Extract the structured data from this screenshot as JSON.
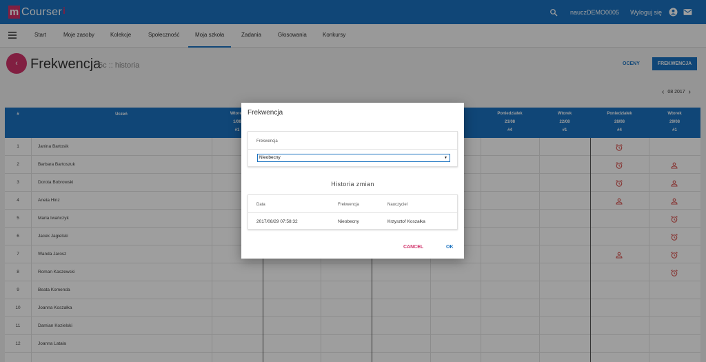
{
  "app": {
    "logo_box": "m",
    "logo_text": "Courser",
    "logo_mark": "i",
    "username": "nauczDEMO0005",
    "logout": "Wyloguj się"
  },
  "nav": {
    "items": [
      "Start",
      "Moje zasoby",
      "Kolekcje",
      "Społeczność",
      "Moja szkoła",
      "Zadania",
      "Głosowania",
      "Konkursy"
    ],
    "active": "Moja szkoła"
  },
  "page": {
    "back_glyph": "‹",
    "title": "Frekwencja",
    "subtitle": "5c :: historia",
    "btn_oceny": "OCENY",
    "btn_frekwencja": "FREKWENCJA"
  },
  "month": {
    "label": "08 2017",
    "prev": "‹",
    "next": "›"
  },
  "grid": {
    "col_num": "#",
    "col_student": "Uczeń",
    "lessons": [
      {
        "day": "Wtorek",
        "date": "1/08",
        "lesson": "#1"
      },
      {
        "day": "Poniedziałek",
        "date": "21/08",
        "lesson": "#4"
      },
      {
        "day": "Wtorek",
        "date": "22/08",
        "lesson": "#1"
      },
      {
        "day": "Poniedziałek",
        "date": "28/08",
        "lesson": "#4"
      },
      {
        "day": "Wtorek",
        "date": "29/08",
        "lesson": "#1"
      }
    ],
    "students": [
      {
        "n": "1",
        "name": "Janina Bartosik",
        "m28": "late",
        "m29": ""
      },
      {
        "n": "2",
        "name": "Barbara Bartoszuk",
        "m28": "late",
        "m29": "absent"
      },
      {
        "n": "3",
        "name": "Dorota Bobrowski",
        "m28": "late",
        "m29": "absent"
      },
      {
        "n": "4",
        "name": "Aneta Hinz",
        "m28": "absent",
        "m29": "absent"
      },
      {
        "n": "5",
        "name": "Maria Iwańczyk",
        "m28": "",
        "m29": "late"
      },
      {
        "n": "6",
        "name": "Jacek Jagielski",
        "m28": "",
        "m29": "late"
      },
      {
        "n": "7",
        "name": "Wanda Jarosz",
        "m28": "absent",
        "m29": "late"
      },
      {
        "n": "8",
        "name": "Roman Kaszewski",
        "m28": "",
        "m29": "late"
      },
      {
        "n": "9",
        "name": "Beata Komenda",
        "m28": "",
        "m29": ""
      },
      {
        "n": "10",
        "name": "Joanna Koszałka",
        "m28": "",
        "m29": ""
      },
      {
        "n": "11",
        "name": "Damian Kozielski",
        "m28": "",
        "m29": ""
      },
      {
        "n": "12",
        "name": "Joanna Latała",
        "m28": "",
        "m29": ""
      }
    ],
    "icons": {
      "late": "alarm-clock-icon",
      "absent": "person-icon"
    }
  },
  "modal": {
    "title": "Frekwencja",
    "field_label": "Frekwencja",
    "select_value": "Nieobecny",
    "history_title": "Historia zmian",
    "history_headers": [
      "Data",
      "Frekwencja",
      "Nauczyciel"
    ],
    "history_rows": [
      [
        "2017/08/29 07:58:32",
        "Nieobecny",
        "Krzysztof Koszałka"
      ]
    ],
    "cancel": "CANCEL",
    "ok": "OK"
  },
  "colors": {
    "primary": "#1a72c0",
    "accent": "#d1326a",
    "mark": "#d9534f"
  }
}
